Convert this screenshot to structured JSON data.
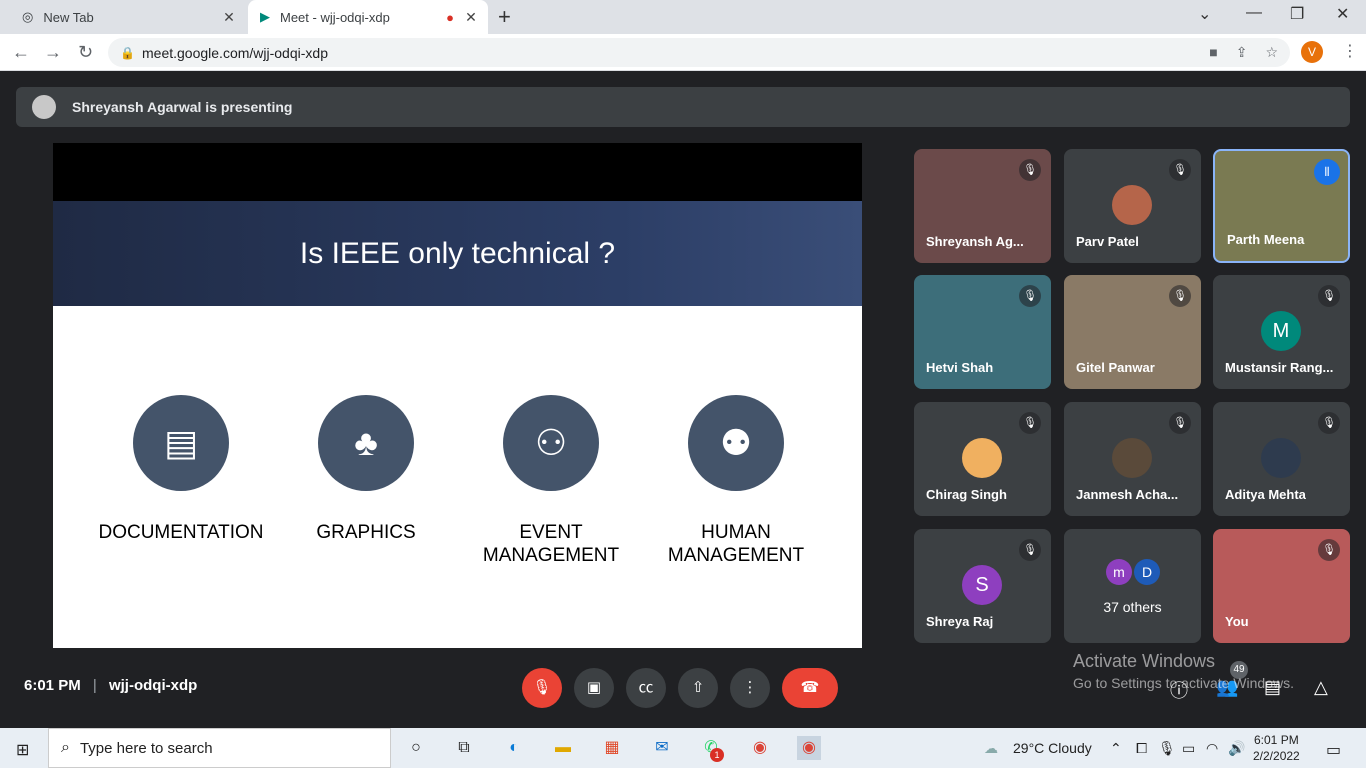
{
  "browser": {
    "tabs": [
      {
        "label": "New Tab"
      },
      {
        "label": "Meet - wjj-odqi-xdp"
      }
    ],
    "url": "meet.google.com/wjj-odqi-xdp",
    "profile_initial": "V"
  },
  "meet": {
    "presenting_text": "Shreyansh Agarwal is presenting",
    "slide": {
      "title": "Is IEEE only technical ?",
      "items": [
        {
          "label": "DOCUMENTATION"
        },
        {
          "label": "GRAPHICS"
        },
        {
          "label": "EVENT MANAGEMENT"
        },
        {
          "label": "HUMAN MANAGEMENT"
        }
      ]
    },
    "participants": [
      {
        "name": "Shreyansh Ag..."
      },
      {
        "name": "Parv Patel"
      },
      {
        "name": "Parth Meena"
      },
      {
        "name": "Hetvi Shah"
      },
      {
        "name": "Gitel Panwar"
      },
      {
        "name": "Mustansir Rang...",
        "initial": "M"
      },
      {
        "name": "Chirag Singh"
      },
      {
        "name": "Janmesh Acha..."
      },
      {
        "name": "Aditya Mehta"
      },
      {
        "name": "Shreya Raj",
        "initial": "S"
      },
      {
        "name": "37 others",
        "initials": [
          "m",
          "D"
        ]
      },
      {
        "name": "You"
      }
    ],
    "time": "6:01 PM",
    "meeting_code": "wjj-odqi-xdp",
    "people_count": "49"
  },
  "activate": {
    "line1": "Activate Windows",
    "line2": "Go to Settings to activate Windows."
  },
  "taskbar": {
    "search_placeholder": "Type here to search",
    "whatsapp_badge": "1",
    "weather": "29°C  Cloudy",
    "clock_time": "6:01 PM",
    "clock_date": "2/2/2022"
  },
  "colors": {
    "meet_bg": "#202124",
    "tile_bg": "#3c4043",
    "end_call": "#ea4335",
    "slide_circle": "#44546a"
  }
}
